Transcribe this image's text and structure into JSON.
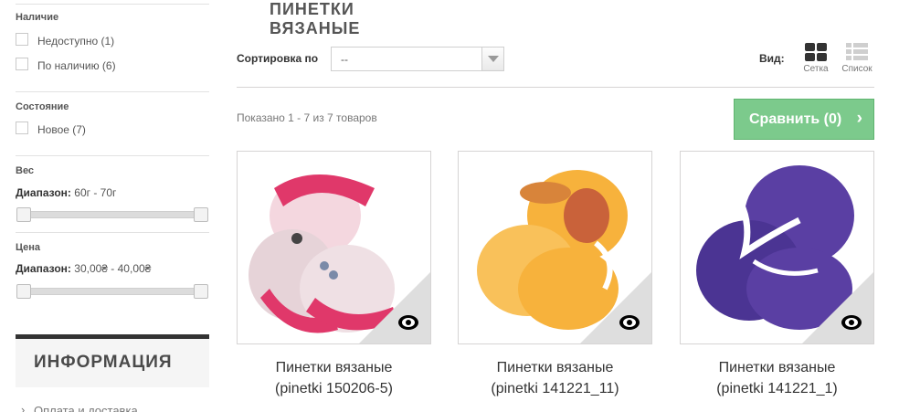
{
  "sidebar": {
    "availability": {
      "heading": "Наличие",
      "options": [
        {
          "label": "Недоступно (1)"
        },
        {
          "label": "По наличию (6)"
        }
      ]
    },
    "condition": {
      "heading": "Состояние",
      "options": [
        {
          "label": "Новое (7)"
        }
      ]
    },
    "weight": {
      "heading": "Вес",
      "range_label": "Диапазон:",
      "range_value": "60г - 70г"
    },
    "price": {
      "heading": "Цена",
      "range_label": "Диапазон:",
      "range_value": "30,00₴ - 40,00₴"
    },
    "info": {
      "title": "ИНФОРМАЦИЯ",
      "links": [
        "Оплата и доставка"
      ]
    }
  },
  "main": {
    "title_line1": "ПИНЕТКИ",
    "title_line2": "ВЯЗАНЫЕ",
    "sort_label": "Сортировка по",
    "sort_value": "--",
    "view_label": "Вид:",
    "view_grid": "Сетка",
    "view_list": "Список",
    "results": "Показано 1 - 7 из 7 товаров",
    "compare_label": "Сравнить (0)",
    "products": [
      {
        "name_line1": "Пинетки вязаные",
        "name_line2": "(pinetki 150206-5)",
        "color": "#e0386a"
      },
      {
        "name_line1": "Пинетки вязаные",
        "name_line2": "(pinetki 141221_11)",
        "color": "#f7b23c"
      },
      {
        "name_line1": "Пинетки вязаные",
        "name_line2": "(pinetki 141221_1)",
        "color": "#5a3fa3"
      }
    ]
  },
  "colors": {
    "accent_green": "#7cca8c",
    "dark": "#333333"
  }
}
